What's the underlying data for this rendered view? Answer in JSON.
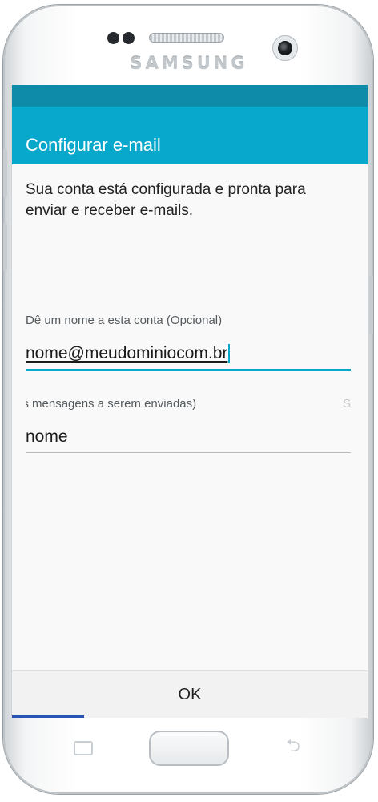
{
  "device": {
    "brand": "SAMSUNG"
  },
  "appbar": {
    "title": "Configurar e-mail"
  },
  "content": {
    "intro": "Sua conta está configurada e pronta para enviar e receber e-mails.",
    "account_name": {
      "label": "Dê um nome a esta conta (Opcional)",
      "value": "nome@meudominiocom.br"
    },
    "sender_name": {
      "label": "as mensagens a serem enviadas)",
      "trailing": "S",
      "value": "nome"
    }
  },
  "footer": {
    "ok_label": "OK"
  },
  "colors": {
    "accent": "#08a8cc",
    "status_bar": "#0e8ba9"
  },
  "icons": [
    "recent-apps-icon",
    "home-button",
    "back-icon",
    "camera-icon",
    "speaker-icon"
  ]
}
